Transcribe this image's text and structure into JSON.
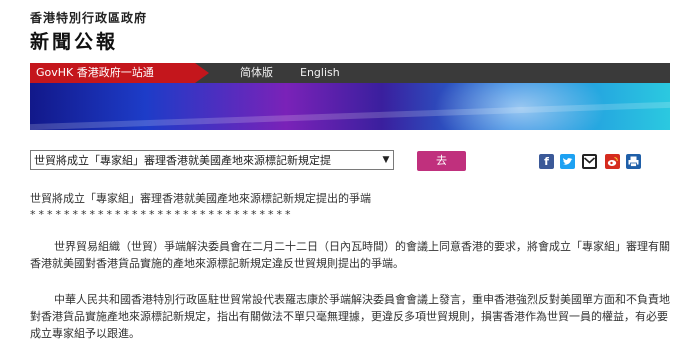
{
  "header": {
    "gov_name": "香港特別行政區政府",
    "press_title": "新聞公報"
  },
  "nav": {
    "govhk": "GovHK 香港政府一站通",
    "simplified": "简体版",
    "english": "English"
  },
  "toolbar": {
    "select_value": "世貿將成立「專家組」審理香港就美國產地來源標記新規定提",
    "go_label": "去"
  },
  "share_icons": [
    "facebook-icon",
    "twitter-icon",
    "email-icon",
    "weibo-icon",
    "print-icon"
  ],
  "colors": {
    "govhk_red": "#c4161c",
    "nav_dark": "#3a3a3a",
    "go_button": "#c0307d"
  },
  "article": {
    "headline": "世貿將成立「專家組」審理香港就美國產地來源標記新規定提出的爭端",
    "stars": "*******************************",
    "paragraphs": [
      "世界貿易組織（世貿）爭端解決委員會在二月二十二日（日內瓦時間）的會議上同意香港的要求，將會成立「專家組」審理有關香港就美國對香港貨品實施的產地來源標記新規定違反世貿規則提出的爭端。",
      "中華人民共和國香港特別行政區駐世貿常設代表羅志康於爭端解決委員會會議上發言，重申香港強烈反對美國單方面和不負責地對香港貨品實施產地來源標記新規定，指出有關做法不單只毫無理據，更違反多項世貿規則，損害香港作為世貿一員的權益，有必要成立專家組予以跟進。"
    ]
  }
}
